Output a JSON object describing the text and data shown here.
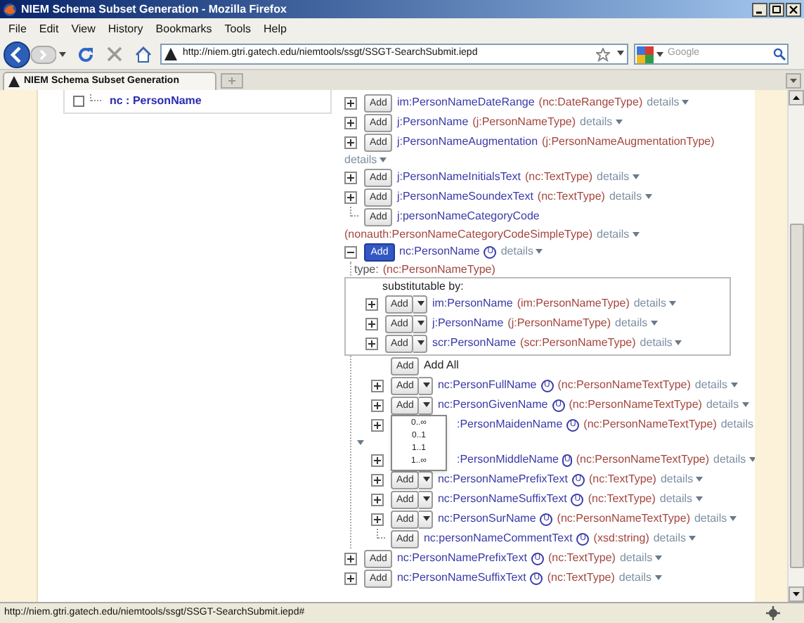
{
  "window": {
    "title": "NIEM Schema Subset Generation - Mozilla Firefox"
  },
  "menu": [
    "File",
    "Edit",
    "View",
    "History",
    "Bookmarks",
    "Tools",
    "Help"
  ],
  "toolbar": {
    "address": "http://niem.gtri.gatech.edu/niemtools/ssgt/SSGT-SearchSubmit.iepd",
    "search_placeholder": "Google"
  },
  "tabs": [
    {
      "label": "NIEM Schema Subset Generation",
      "selected": true
    }
  ],
  "left_tree": [
    {
      "label": "nc : PersonName",
      "checked": false
    }
  ],
  "tree": [
    {
      "kind": "branch",
      "expanded": false,
      "button": "Add",
      "dropdown": false,
      "selected": false,
      "name": "im:PersonNameDateRange",
      "type": "(nc:DateRangeType)",
      "details": "details"
    },
    {
      "kind": "branch",
      "expanded": false,
      "button": "Add",
      "dropdown": false,
      "selected": false,
      "name": "j:PersonName",
      "type": "(j:PersonNameType)",
      "details": "details"
    },
    {
      "kind": "branch",
      "expanded": false,
      "button": "Add",
      "dropdown": false,
      "selected": false,
      "name": "j:PersonNameAugmentation",
      "type": "(j:PersonNameAugmentationType)",
      "continued": {
        "details": "details"
      }
    },
    {
      "kind": "branch",
      "expanded": false,
      "button": "Add",
      "dropdown": false,
      "selected": false,
      "name": "j:PersonNameInitialsText",
      "type": "(nc:TextType)",
      "details": "details"
    },
    {
      "kind": "branch",
      "expanded": false,
      "button": "Add",
      "dropdown": false,
      "selected": false,
      "name": "j:PersonNameSoundexText",
      "type": "(nc:TextType)",
      "details": "details"
    },
    {
      "kind": "leaf",
      "button": "Add",
      "dropdown": false,
      "selected": false,
      "name": "j:personNameCategoryCode",
      "continued": {
        "type": "(nonauth:PersonNameCategoryCodeSimpleType)",
        "details": "details"
      }
    },
    {
      "kind": "branch",
      "expanded": true,
      "button": "Add",
      "dropdown": false,
      "selected": true,
      "name": "nc:PersonName",
      "badge": "U",
      "details": "details",
      "children": [
        {
          "kind": "type_line",
          "label": "type:",
          "type": "(nc:PersonNameType)"
        },
        {
          "kind": "substitution",
          "label": "substitutable by:",
          "items": [
            {
              "kind": "branch",
              "expanded": false,
              "button": "Add",
              "dropdown": true,
              "selected": false,
              "name": "im:PersonName",
              "type": "(im:PersonNameType)",
              "details": "details"
            },
            {
              "kind": "branch",
              "expanded": false,
              "button": "Add",
              "dropdown": true,
              "selected": false,
              "name": "j:PersonName",
              "type": "(j:PersonNameType)",
              "details": "details"
            },
            {
              "kind": "branch",
              "expanded": false,
              "button": "Add",
              "dropdown": true,
              "selected": false,
              "name": "scr:PersonName",
              "type": "(scr:PersonNameType)",
              "details": "details"
            }
          ]
        },
        {
          "kind": "add_all",
          "button": "Add",
          "label": "Add All"
        },
        {
          "kind": "branch",
          "expanded": false,
          "button": "Add",
          "dropdown": true,
          "selected": false,
          "name": "nc:PersonFullName",
          "badge": "U",
          "type": "(nc:PersonNameTextType)",
          "details": "details"
        },
        {
          "kind": "branch",
          "expanded": false,
          "button": "Add",
          "dropdown": true,
          "selected": false,
          "name": "nc:PersonGivenName",
          "badge": "U",
          "type": "(nc:PersonNameTextType)",
          "details": "details",
          "menu": [
            "0..∞",
            "0..1",
            "1..1",
            "1..∞"
          ]
        },
        {
          "kind": "branch",
          "expanded": false,
          "name": ":PersonMaidenName",
          "badge": "U",
          "type": "(nc:PersonNameTextType)",
          "details": "details",
          "caret_wrapped": true
        },
        {
          "kind": "branch",
          "expanded": false,
          "name": ":PersonMiddleName",
          "badge": "U",
          "type": "(nc:PersonNameTextType)",
          "details": "details"
        },
        {
          "kind": "branch",
          "expanded": false,
          "button": "Add",
          "dropdown": true,
          "selected": false,
          "name": "nc:PersonNamePrefixText",
          "badge": "U",
          "type": "(nc:TextType)",
          "details": "details"
        },
        {
          "kind": "branch",
          "expanded": false,
          "button": "Add",
          "dropdown": true,
          "selected": false,
          "name": "nc:PersonNameSuffixText",
          "badge": "U",
          "type": "(nc:TextType)",
          "details": "details"
        },
        {
          "kind": "branch",
          "expanded": false,
          "button": "Add",
          "dropdown": true,
          "selected": false,
          "name": "nc:PersonSurName",
          "badge": "U",
          "type": "(nc:PersonNameTextType)",
          "details": "details"
        },
        {
          "kind": "leaf",
          "button": "Add",
          "dropdown": false,
          "selected": false,
          "name": "nc:personNameCommentText",
          "badge": "U",
          "type": "(xsd:string)",
          "details": "details"
        }
      ]
    },
    {
      "kind": "branch",
      "expanded": false,
      "button": "Add",
      "dropdown": false,
      "selected": false,
      "name": "nc:PersonNamePrefixText",
      "badge": "U",
      "type": "(nc:TextType)",
      "details": "details"
    },
    {
      "kind": "branch",
      "expanded": false,
      "button": "Add",
      "dropdown": false,
      "selected": false,
      "name": "nc:PersonNameSuffixText",
      "badge": "U",
      "type": "(nc:TextType)",
      "details": "details"
    }
  ],
  "status_bar": {
    "text": "http://niem.gtri.gatech.edu/niemtools/ssgt/SSGT-SearchSubmit.iepd#"
  }
}
